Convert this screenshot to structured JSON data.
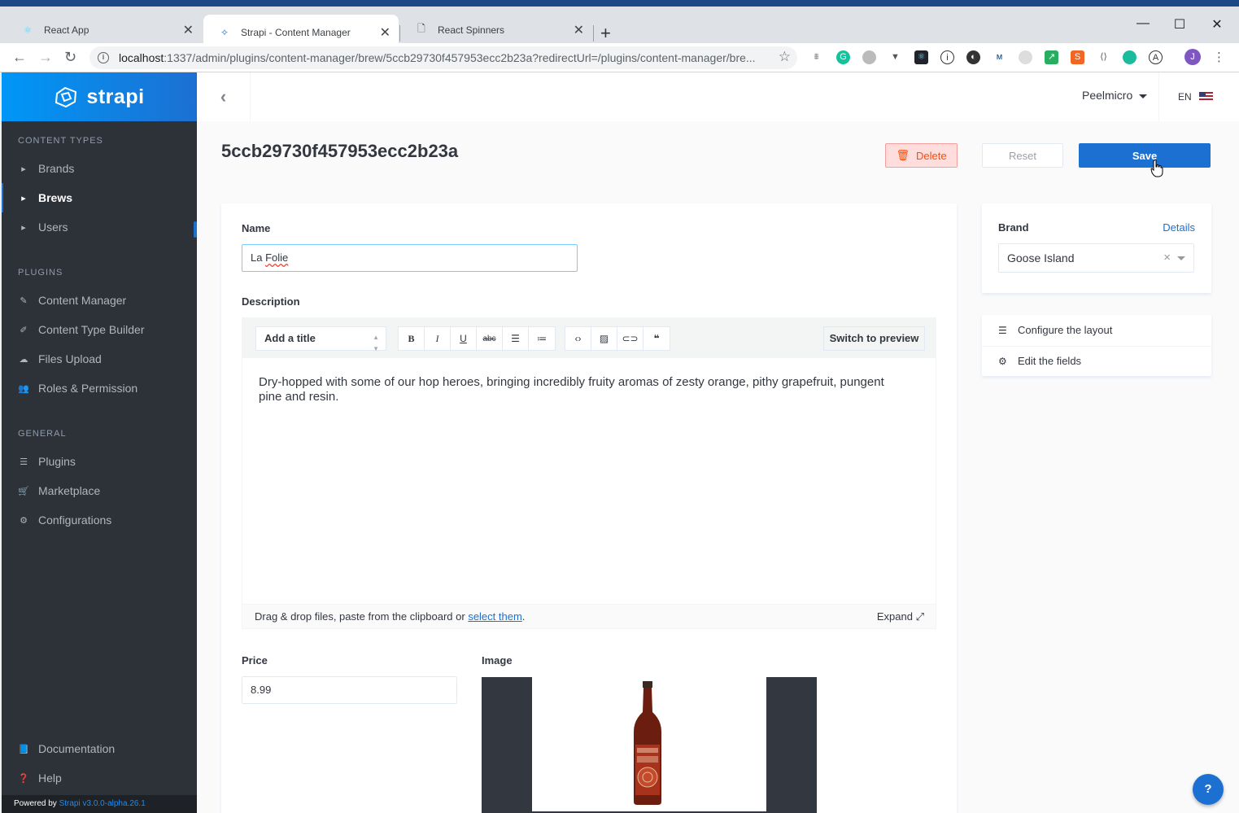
{
  "browser": {
    "tabs": [
      {
        "label": "React App",
        "icon": "react-icon"
      },
      {
        "label": "Strapi - Content Manager",
        "icon": "strapi-icon"
      },
      {
        "label": "React Spinners",
        "icon": "page-icon"
      }
    ],
    "url_host": "localhost",
    "url_path": ":1337/admin/plugins/content-manager/brew/5ccb29730f457953ecc2b23a?redirectUrl=/plugins/content-manager/bre..."
  },
  "sidebar": {
    "brand": "strapi",
    "sections": {
      "content_types": "CONTENT TYPES",
      "plugins": "PLUGINS",
      "general": "GENERAL"
    },
    "content_types": [
      {
        "label": "Brands"
      },
      {
        "label": "Brews"
      },
      {
        "label": "Users"
      }
    ],
    "plugins": [
      {
        "label": "Content Manager"
      },
      {
        "label": "Content Type Builder"
      },
      {
        "label": "Files Upload"
      },
      {
        "label": "Roles & Permission"
      }
    ],
    "general": [
      {
        "label": "Plugins"
      },
      {
        "label": "Marketplace"
      },
      {
        "label": "Configurations"
      }
    ],
    "footer": [
      {
        "label": "Documentation"
      },
      {
        "label": "Help"
      }
    ],
    "powered_by": "Powered by",
    "version": "Strapi v3.0.0-alpha.26.1"
  },
  "header": {
    "user": "Peelmicro",
    "lang": "EN"
  },
  "page": {
    "title": "5ccb29730f457953ecc2b23a",
    "delete_label": "Delete",
    "reset_label": "Reset",
    "save_label": "Save"
  },
  "form": {
    "name_label": "Name",
    "name_value_1": "La",
    "name_value_2": "Folie",
    "description_label": "Description",
    "title_select": "Add a title",
    "switch_preview": "Switch to preview",
    "description_text": "Dry-hopped with some of our hop heroes, bringing incredibly fruity aromas of zesty orange, pithy grapefruit, pungent pine and resin.",
    "drop_text": "Drag & drop files, paste from the clipboard or",
    "drop_link": "select them",
    "drop_end": ".",
    "expand_label": "Expand",
    "price_label": "Price",
    "price_value": "8.99",
    "image_label": "Image"
  },
  "side": {
    "brand_label": "Brand",
    "details_link": "Details",
    "brand_value": "Goose Island",
    "configure_layout": "Configure the layout",
    "edit_fields": "Edit the fields"
  },
  "help_button": "?",
  "colors": {
    "primary": "#1c70d2",
    "sidebar_bg": "#2d3138",
    "delete_bg": "#ffdddd"
  }
}
